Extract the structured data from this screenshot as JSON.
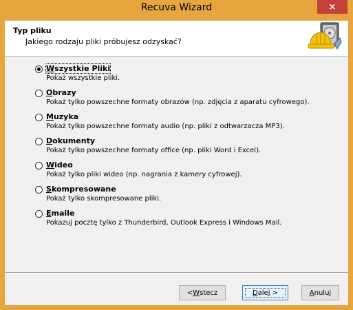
{
  "window": {
    "title": "Recuva Wizard",
    "close_icon": "×"
  },
  "header": {
    "title": "Typ pliku",
    "subtitle": "Jakiego rodzaju pliki próbujesz odzyskać?",
    "logo_icon": "recuva-logo-icon"
  },
  "options": [
    {
      "label": "Wszystkie Pliki",
      "accel": "W",
      "rest": "szystkie Pliki",
      "description": "Pokaż wszystkie pliki.",
      "selected": true
    },
    {
      "label": "Obrazy",
      "accel": "O",
      "rest": "brazy",
      "description": "Pokaż tylko powszechne formaty obrazów (np. zdjęcia z aparatu cyfrowego).",
      "selected": false
    },
    {
      "label": "Muzyka",
      "accel": "M",
      "rest": "uzyka",
      "description": "Pokaż tylko powszechne formaty audio (np. pliki z odtwarzacza MP3).",
      "selected": false
    },
    {
      "label": "Dokumenty",
      "accel": "D",
      "rest": "okumenty",
      "description": "Pokaż tylko powszechne formaty office (np. pliki Word i Excel).",
      "selected": false
    },
    {
      "label": "Wideo",
      "accel": "W",
      "rest": "ideo",
      "description": "Pokaż tylko pliki wideo (np. nagrania z kamery cyfrowej).",
      "selected": false
    },
    {
      "label": "Skompresowane",
      "accel": "S",
      "rest": "kompresowane",
      "description": "Pokaż tylko skompresowane pliki.",
      "selected": false
    },
    {
      "label": "Emaile",
      "accel": "E",
      "rest": "maile",
      "description": "Pokazuj pocztę tylko z Thunderbird, Outlook Express i Windows Mail.",
      "selected": false
    }
  ],
  "buttons": {
    "back_prefix": "< ",
    "back_accel": "W",
    "back_rest": "stecz",
    "next_accel": "D",
    "next_rest": "alej >",
    "cancel_accel": "A",
    "cancel_rest": "nuluj"
  }
}
